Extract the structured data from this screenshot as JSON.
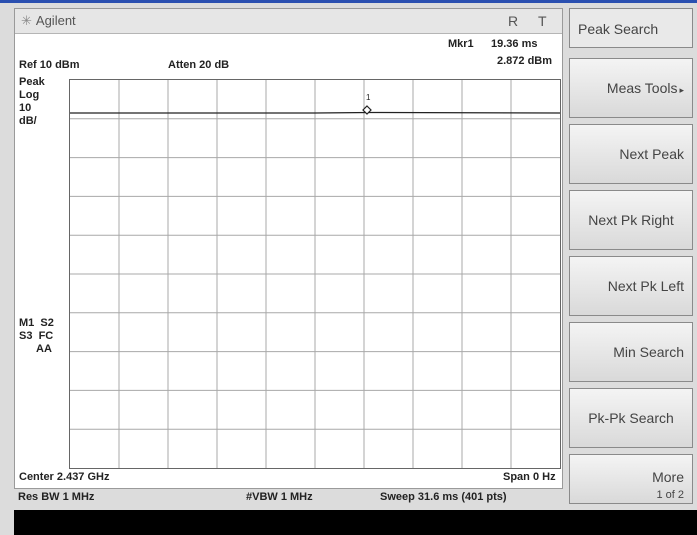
{
  "titlebar": {
    "brand": "Agilent",
    "r": "R",
    "t": "T"
  },
  "marker_readout": {
    "label": "Mkr1",
    "time": "19.36 ms",
    "level": "2.872 dBm"
  },
  "ref": {
    "ref_level": "Ref 10 dBm",
    "atten": "Atten 20 dB"
  },
  "side_labels": [
    "Peak",
    "Log",
    "10",
    "dB/"
  ],
  "status_labels": [
    "M1  S2",
    "S3  FC",
    "AA"
  ],
  "marker_flag": "1",
  "bottom": {
    "center": "Center 2.437 GHz",
    "span": "Span 0 Hz",
    "res_bw": "Res BW 1 MHz",
    "vbw": "#VBW 1 MHz",
    "sweep": "Sweep 31.6 ms (401 pts)"
  },
  "softkeys": {
    "title": "Peak Search",
    "items": [
      {
        "label": "Meas Tools",
        "arrow": "▸"
      },
      {
        "label": "Next Peak"
      },
      {
        "label": "Next Pk Right"
      },
      {
        "label": "Next Pk Left"
      },
      {
        "label": "Min Search"
      },
      {
        "label": "Pk-Pk Search"
      },
      {
        "label": "More",
        "sub": "1 of 2"
      }
    ]
  }
}
